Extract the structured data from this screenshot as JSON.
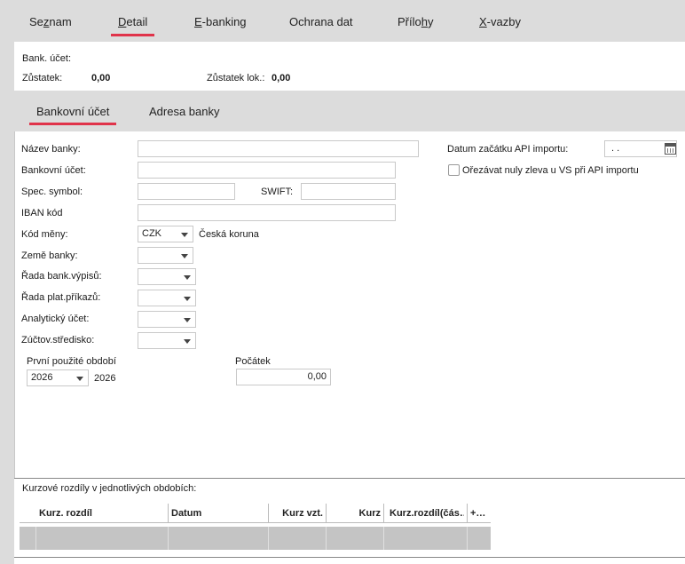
{
  "top_tabs": {
    "seznam": {
      "pre": "Se",
      "ul": "z",
      "post": "nam"
    },
    "detail": {
      "pre": "",
      "ul": "D",
      "post": "etail"
    },
    "ebanking": {
      "pre": "",
      "ul": "E",
      "post": "-banking"
    },
    "ochrana": {
      "pre": "Ochrana dat",
      "ul": "",
      "post": ""
    },
    "prilohy": {
      "pre": "Přílo",
      "ul": "h",
      "post": "y"
    },
    "xvazby": {
      "pre": "",
      "ul": "X",
      "post": "-vazby"
    }
  },
  "info": {
    "bank_account_label": "Bank. účet:",
    "balance_label": "Zůstatek:",
    "balance_value": "0,00",
    "balance_local_label": "Zůstatek lok.:",
    "balance_local_value": "0,00"
  },
  "sub_tabs": {
    "bank_account": "Bankovní účet",
    "bank_address": "Adresa banky"
  },
  "form": {
    "bank_name_label": "Název banky:",
    "bank_name_value": "",
    "bank_account_label": "Bankovní účet:",
    "bank_account_value": "",
    "spec_symbol_label": "Spec. symbol:",
    "spec_symbol_value": "",
    "swift_label": "SWIFT:",
    "swift_value": "",
    "iban_label": "IBAN kód",
    "iban_value": "",
    "currency_label": "Kód měny:",
    "currency_value": "CZK",
    "currency_name": "Česká koruna",
    "country_label": "Země banky:",
    "country_value": "",
    "statement_series_label": "Řada bank.výpisů:",
    "statement_series_value": "",
    "order_series_label": "Řada plat.příkazů:",
    "order_series_value": "",
    "analytic_label": "Analytický účet:",
    "analytic_value": "",
    "center_label": "Zúčtov.středisko:",
    "center_value": "",
    "first_period_label": "První použité období",
    "first_period_value": "2026",
    "first_period_text": "2026",
    "start_label": "Počátek",
    "start_value": "0,00",
    "api_date_label": "Datum začátku API importu:",
    "api_date_value": ". .",
    "trim_zeros_label": "Ořezávat nuly zleva u VS při API importu"
  },
  "grid": {
    "title": "Kurzové rozdíly v jednotlivých obdobích:",
    "columns": [
      "Kurz. rozdíl",
      "Datum",
      "Kurz vzt.",
      "Kurz",
      "Kurz.rozdíl(čás…",
      "+…"
    ]
  },
  "colors": {
    "accent": "#e0334a",
    "bar_bg": "#dcdcdc",
    "row_bg": "#c4c4c4"
  }
}
